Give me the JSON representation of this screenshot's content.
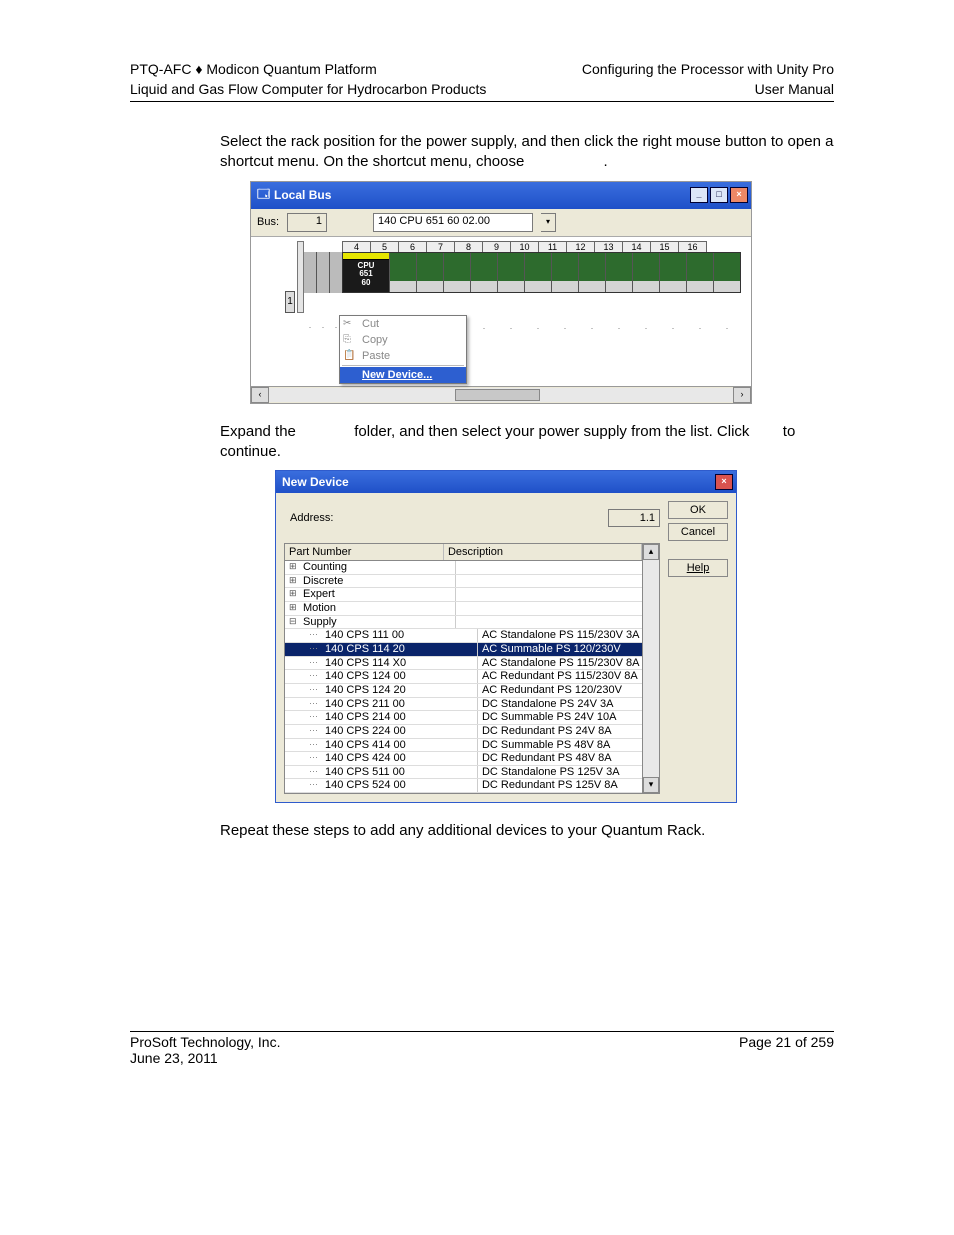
{
  "header": {
    "left1": "PTQ-AFC ♦ Modicon Quantum Platform",
    "left2": "Liquid and Gas Flow Computer for Hydrocarbon Products",
    "right1": "Configuring the Processor with Unity Pro",
    "right2": "User Manual"
  },
  "para1": "Select the rack position for the power supply, and then click the right mouse button to open a shortcut menu. On the shortcut menu, choose",
  "para1_end": ".",
  "para2a": "Expand the ",
  "para2b": " folder, and then select your power supply from the list. Click ",
  "para2c": " to continue.",
  "para3": "Repeat these steps to add any additional devices to your Quantum Rack.",
  "shot1": {
    "title": "Local Bus",
    "busLabel": "Bus:",
    "busNum": "1",
    "cpuSel": "140 CPU 651 60   02.00",
    "slotNums": [
      "4",
      "5",
      "6",
      "7",
      "8",
      "9",
      "10",
      "11",
      "12",
      "13",
      "14",
      "15",
      "16"
    ],
    "cpu": "CPU\n651\n60",
    "rackId": "1",
    "menu": {
      "cut": "Cut",
      "copy": "Copy",
      "paste": "Paste",
      "new": "New Device..."
    }
  },
  "dlg": {
    "title": "New Device",
    "ok": "OK",
    "cancel": "Cancel",
    "help": "Help",
    "address": "Address:",
    "addrVal": "1.1",
    "partNumber": "Part Number",
    "description": "Description",
    "cats": [
      {
        "name": "Counting",
        "open": false
      },
      {
        "name": "Discrete",
        "open": false
      },
      {
        "name": "Expert",
        "open": false
      },
      {
        "name": "Motion",
        "open": false
      },
      {
        "name": "Supply",
        "open": true
      }
    ],
    "items": [
      {
        "pn": "140 CPS 111 00",
        "desc": "AC Standalone PS 115/230V 3A",
        "sel": false
      },
      {
        "pn": "140 CPS 114 20",
        "desc": "AC Summable PS 120/230V",
        "sel": true
      },
      {
        "pn": "140 CPS 114 X0",
        "desc": "AC Standalone PS 115/230V 8A",
        "sel": false
      },
      {
        "pn": "140 CPS 124 00",
        "desc": "AC Redundant PS 115/230V 8A",
        "sel": false
      },
      {
        "pn": "140 CPS 124 20",
        "desc": "AC Redundant PS 120/230V",
        "sel": false
      },
      {
        "pn": "140 CPS 211 00",
        "desc": "DC Standalone PS 24V 3A",
        "sel": false
      },
      {
        "pn": "140 CPS 214 00",
        "desc": "DC Summable PS 24V 10A",
        "sel": false
      },
      {
        "pn": "140 CPS 224 00",
        "desc": "DC Redundant PS 24V  8A",
        "sel": false
      },
      {
        "pn": "140 CPS 414 00",
        "desc": "DC Summable PS 48V 8A",
        "sel": false
      },
      {
        "pn": "140 CPS 424 00",
        "desc": "DC Redundant PS 48V 8A",
        "sel": false
      },
      {
        "pn": "140 CPS 511 00",
        "desc": "DC Standalone PS 125V 3A",
        "sel": false
      },
      {
        "pn": "140 CPS 524 00",
        "desc": "DC Redundant PS 125V 8A",
        "sel": false
      }
    ]
  },
  "footer": {
    "company": "ProSoft Technology, Inc.",
    "date": "June 23, 2011",
    "page": "Page 21 of 259"
  }
}
